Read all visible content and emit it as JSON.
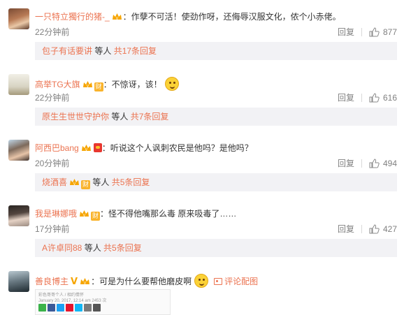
{
  "comments": [
    {
      "username": "一只特立獨行的猪-_",
      "text": "：作孽不可活！使劲作呀，还侮辱汉服文化，侬个小赤佬。",
      "time": "22分钟前",
      "reply_label": "回复",
      "likes": "877",
      "subreply": {
        "name": "包子有话要讲",
        "mid": " 等人 ",
        "more": "共17条回复"
      }
    },
    {
      "username": "高举TG大旗",
      "text": "：不惊讶，该！",
      "time": "22分钟前",
      "reply_label": "回复",
      "likes": "616",
      "subreply": {
        "name": "原生生世世守护你",
        "mid": " 等人 ",
        "more": "共7条回复"
      }
    },
    {
      "username": "阿西巴bang",
      "text": "：听说这个人讽刺农民是他吗？是他吗？",
      "time": "20分钟前",
      "reply_label": "回复",
      "likes": "494",
      "subreply": {
        "name": "烧酒喜",
        "mid": " 等人 ",
        "more": "共5条回复"
      }
    },
    {
      "username": "我是琳娜哦",
      "text": "：怪不得他嘴那么毒 原来吸毒了……",
      "time": "17分钟前",
      "reply_label": "回复",
      "likes": "427",
      "subreply": {
        "name": "A许卓同88",
        "mid": " 等人 ",
        "more": "共5条回复"
      }
    },
    {
      "username": "善良博主",
      "text": "：可是为什么要帮他磨皮啊",
      "pic_link": "评论配图",
      "thumb_line1": "彩色哥哥个人 / 相约情怀",
      "thumb_line2": "January 20, 2017, 12:14 am 2453 次"
    }
  ],
  "badge_cai": "财",
  "colors": {
    "username": "#eb7350",
    "meta": "#808080",
    "subbox_bg": "#f2f2f5",
    "text": "#333333"
  },
  "icons": [
    "vip-crown-icon",
    "cai-badge-icon",
    "red-envelope-icon",
    "v-verified-icon",
    "emoji-icon",
    "like-thumb-icon",
    "picture-icon",
    "share-icon"
  ]
}
